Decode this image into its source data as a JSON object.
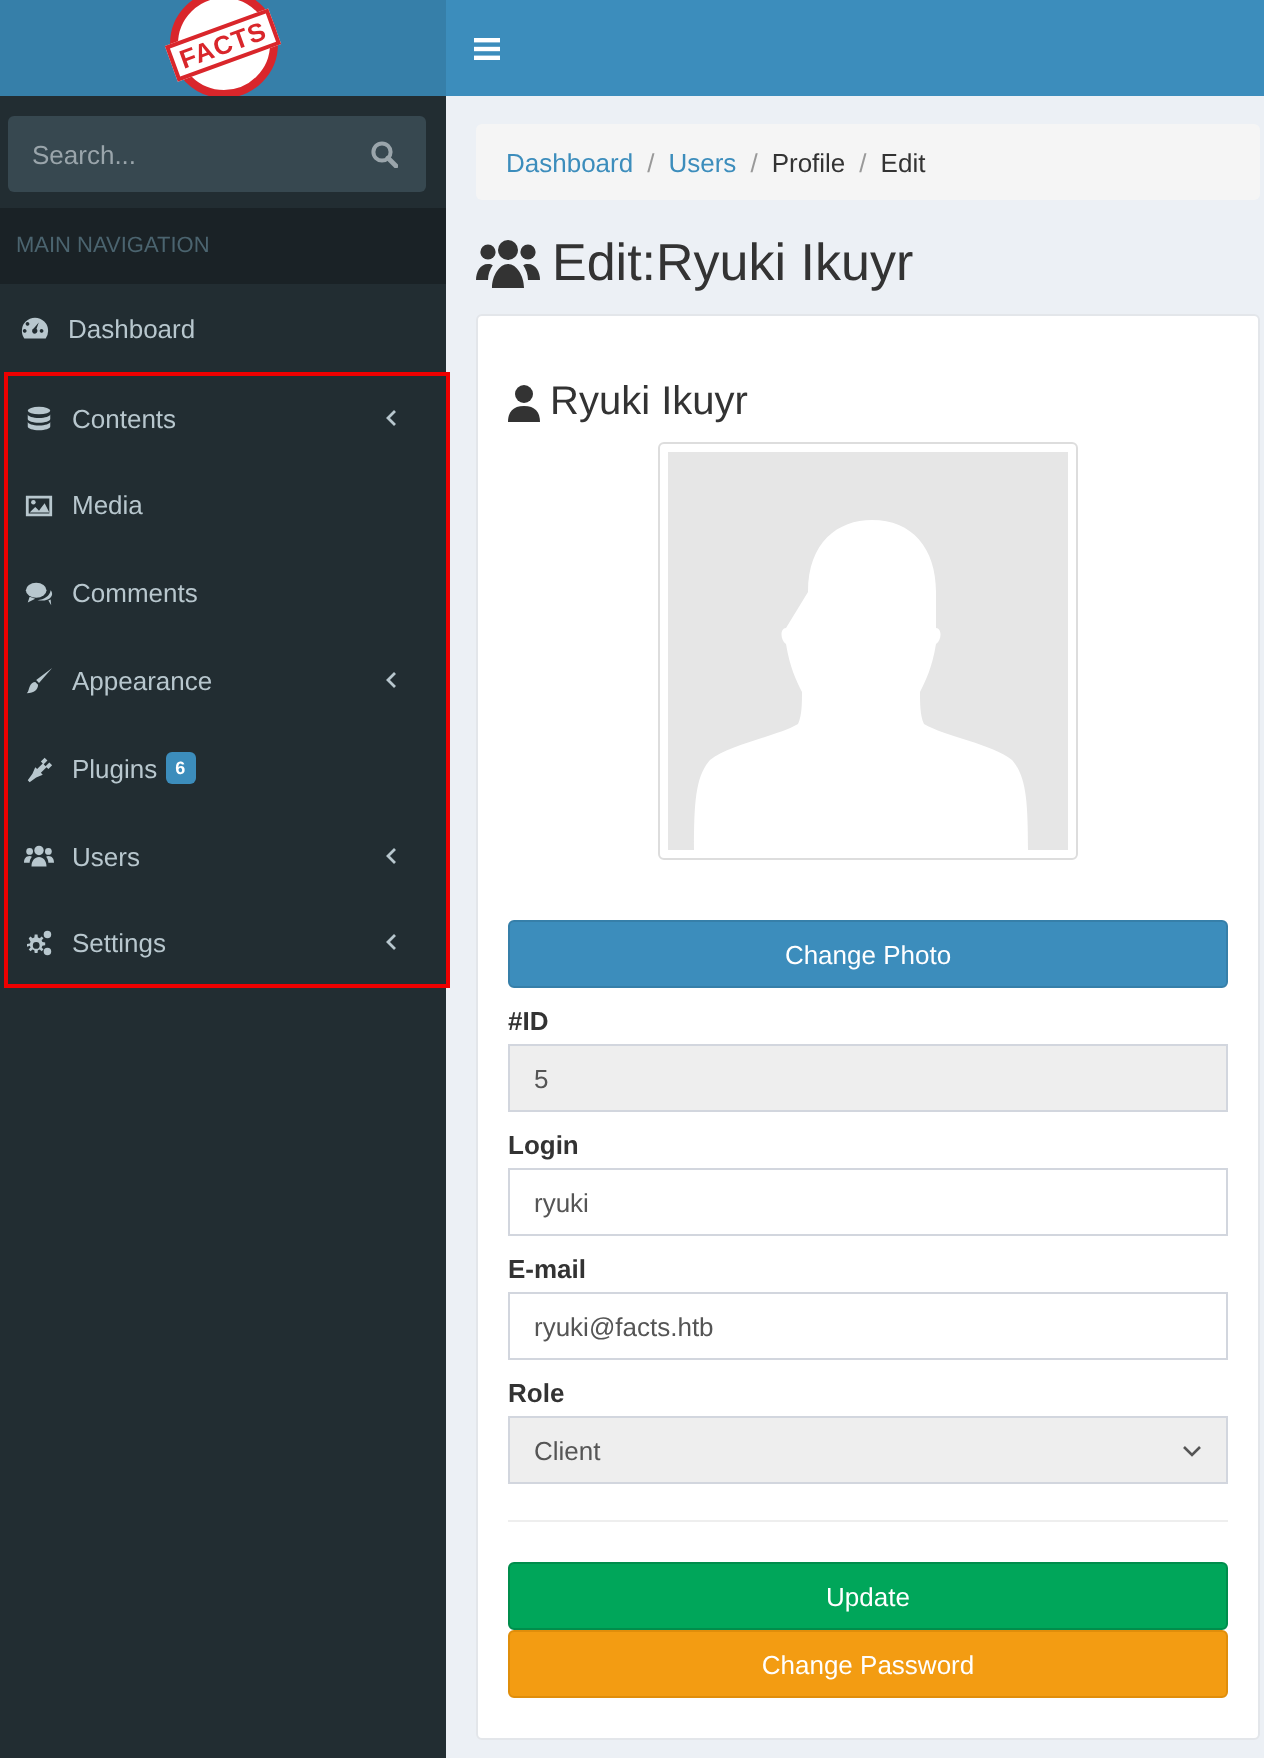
{
  "logo": {
    "text": "FACTS"
  },
  "search": {
    "placeholder": "Search..."
  },
  "sidebar": {
    "header": "MAIN NAVIGATION",
    "items": [
      {
        "label": "Dashboard",
        "expandable": false,
        "highlighted": false
      },
      {
        "label": "Contents",
        "expandable": true,
        "highlighted": true
      },
      {
        "label": "Media",
        "expandable": false,
        "highlighted": true
      },
      {
        "label": "Comments",
        "expandable": false,
        "highlighted": true
      },
      {
        "label": "Appearance",
        "expandable": true,
        "highlighted": true
      },
      {
        "label": "Plugins",
        "badge": "6",
        "expandable": false,
        "highlighted": true
      },
      {
        "label": "Users",
        "expandable": true,
        "highlighted": true
      },
      {
        "label": "Settings",
        "expandable": true,
        "highlighted": true
      }
    ]
  },
  "breadcrumb_separator": "/",
  "breadcrumb": [
    {
      "label": "Dashboard",
      "link": true
    },
    {
      "label": "Users",
      "link": true
    },
    {
      "label": "Profile",
      "link": false
    },
    {
      "label": "Edit",
      "link": false
    }
  ],
  "page_title": "Edit:Ryuki Ikuyr",
  "profile": {
    "name": "Ryuki Ikuyr",
    "change_photo": "Change Photo",
    "fields": [
      {
        "kind": "text",
        "label": "#ID",
        "value": "5",
        "disabled": true
      },
      {
        "kind": "text",
        "label": "Login",
        "value": "ryuki",
        "disabled": false
      },
      {
        "kind": "text",
        "label": "E-mail",
        "value": "ryuki@facts.htb",
        "disabled": false
      },
      {
        "kind": "select",
        "label": "Role",
        "value": "Client"
      }
    ],
    "buttons": [
      {
        "kind": "success",
        "label": "Update"
      },
      {
        "kind": "warning",
        "label": "Change Password"
      }
    ]
  }
}
